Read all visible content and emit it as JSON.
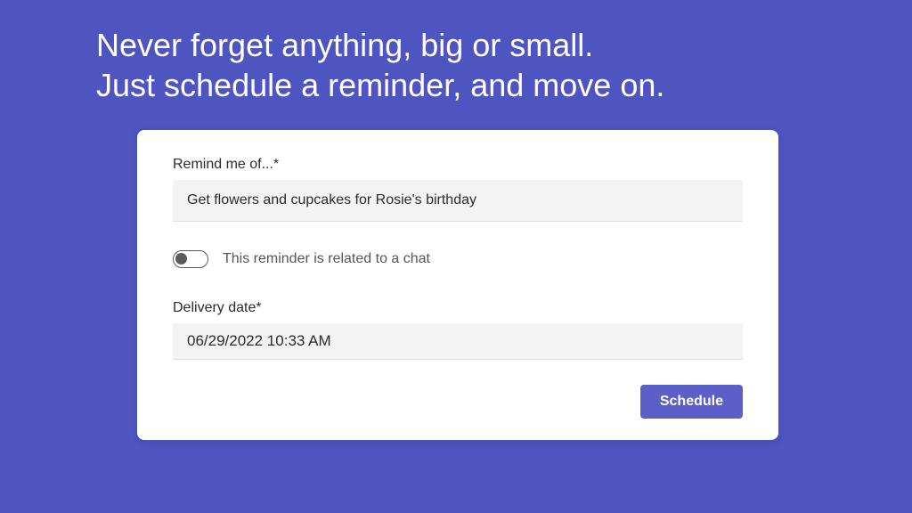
{
  "headline": {
    "line1": "Never forget anything, big or small.",
    "line2": "Just schedule a reminder, and move on."
  },
  "form": {
    "remind_label": "Remind me of...*",
    "remind_value": "Get flowers and cupcakes for Rosie's birthday",
    "toggle_label": "This reminder is related to a chat",
    "toggle_state": "off",
    "date_label": "Delivery date*",
    "date_value": "06/29/2022 10:33 AM",
    "schedule_button": "Schedule"
  },
  "colors": {
    "background": "#4e54c0",
    "button": "#5b5fc7",
    "card": "#ffffff",
    "input_bg": "#f3f3f3"
  }
}
